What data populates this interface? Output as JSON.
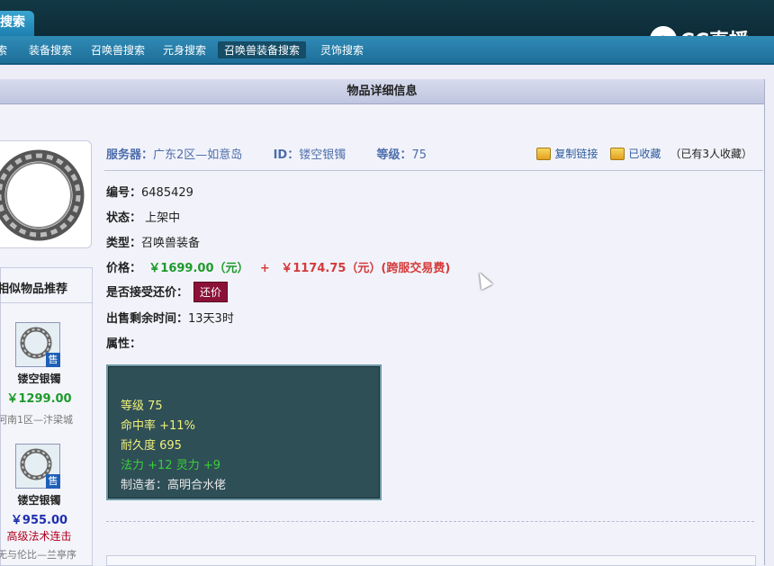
{
  "header": {
    "tab_label": "搜索",
    "logo_text": "CC直播"
  },
  "nav": {
    "items": [
      "索",
      "装备搜索",
      "召唤兽搜索",
      "元身搜索",
      "召唤兽装备搜索",
      "灵饰搜索"
    ],
    "active_index": 4
  },
  "panel": {
    "title": "物品详细信息"
  },
  "item": {
    "server_label": "服务器：",
    "server": "广东2区—如意岛",
    "id_label": "ID：",
    "id": "镂空银镯",
    "level_label": "等级：",
    "level": "75",
    "copy_link": "复制链接",
    "favorited": "已收藏",
    "fav_count_text": "（已有3人收藏）",
    "number_label": "编号：",
    "number": "6485429",
    "status_label": "状态：",
    "status": "上架中",
    "type_label": "类型：",
    "type": "召唤兽装备",
    "price_label": "价格：",
    "price": "￥1699.00（元）",
    "plus": "+",
    "fee": "￥1174.75（元）(跨服交易费)",
    "bargain_label": "是否接受还价：",
    "bargain_button": "还价",
    "remaining_label": "出售剩余时间：",
    "remaining": "13天3时",
    "attributes_label": "属性："
  },
  "attributes": {
    "level": "等级 75",
    "hit": "命中率 +11%",
    "durability": "耐久度 695",
    "magic": "法力 +12 灵力 +9",
    "maker": "制造者：高明合水佬"
  },
  "similar": {
    "title": "相似物品推荐",
    "items": [
      {
        "name": "镂空银镯",
        "price": "￥1299.00",
        "location": "河南1区—汴梁城",
        "extra": ""
      },
      {
        "name": "镂空银镯",
        "price": "￥955.00",
        "extra": "高级法术连击",
        "location": "无与伦比—兰亭序"
      }
    ],
    "sell_badge": "售"
  },
  "colors": {
    "price_green": "#1d9a2b",
    "price_blue": "#1d2fb0",
    "attr_yellow": "#f0f07a",
    "attr_green": "#38d038",
    "attr_white": "#e8e8e8"
  }
}
